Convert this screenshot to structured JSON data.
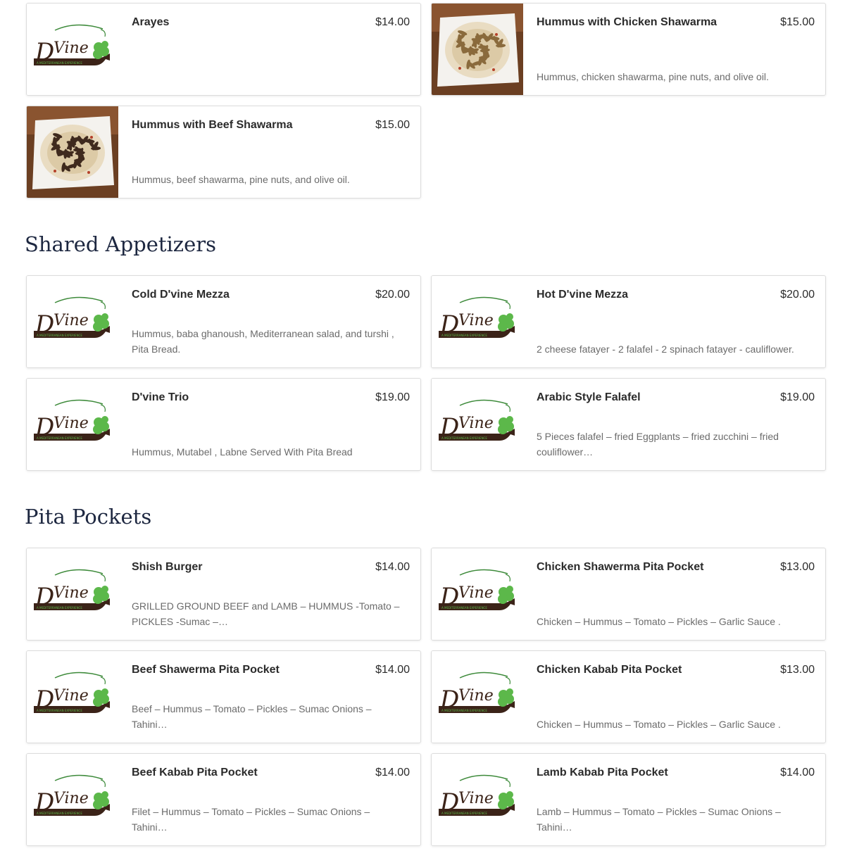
{
  "sections": [
    {
      "title": "",
      "items": [
        {
          "name": "Arayes",
          "price": "$14.00",
          "description": "",
          "image": "logo"
        },
        {
          "name": "Hummus with Chicken Shawarma",
          "price": "$15.00",
          "description": "Hummus, chicken shawarma, pine nuts, and olive oil.",
          "image": "photo-chicken"
        },
        {
          "name": "Hummus with Beef Shawarma",
          "price": "$15.00",
          "description": "Hummus, beef shawarma, pine nuts, and olive oil.",
          "image": "photo-beef"
        }
      ]
    },
    {
      "title": "Shared Appetizers",
      "items": [
        {
          "name": "Cold D'vine Mezza",
          "price": "$20.00",
          "description": "Hummus, baba ghanoush, Mediterranean salad, and turshi , Pita Bread.",
          "image": "logo"
        },
        {
          "name": "Hot D'vine Mezza",
          "price": "$20.00",
          "description": "2 cheese fatayer - 2 falafel - 2 spinach fatayer - cauliflower.",
          "image": "logo"
        },
        {
          "name": "D'vine Trio",
          "price": "$19.00",
          "description": "Hummus, Mutabel , Labne Served With Pita Bread",
          "image": "logo"
        },
        {
          "name": "Arabic Style Falafel",
          "price": "$19.00",
          "description": "5 Pieces falafel – fried Eggplants – fried zucchini – fried couliflower…",
          "image": "logo"
        }
      ]
    },
    {
      "title": "Pita Pockets",
      "items": [
        {
          "name": "Shish Burger",
          "price": "$14.00",
          "description": "GRILLED GROUND BEEF and LAMB – HUMMUS -Tomato – PICKLES -Sumac –…",
          "image": "logo"
        },
        {
          "name": "Chicken Shawerma Pita Pocket",
          "price": "$13.00",
          "description": "Chicken  – Hummus – Tomato – Pickles – Garlic Sauce .",
          "image": "logo"
        },
        {
          "name": "Beef Shawerma Pita Pocket",
          "price": "$14.00",
          "description": "Beef – Hummus – Tomato – Pickles – Sumac Onions – Tahini…",
          "image": "logo"
        },
        {
          "name": "Chicken Kabab Pita Pocket",
          "price": "$13.00",
          "description": "Chicken – Hummus – Tomato – Pickles – Garlic Sauce .",
          "image": "logo"
        },
        {
          "name": "Beef Kabab Pita Pocket",
          "price": "$14.00",
          "description": "Filet – Hummus – Tomato – Pickles – Sumac Onions – Tahini…",
          "image": "logo"
        },
        {
          "name": "Lamb Kabab Pita Pocket",
          "price": "$14.00",
          "description": "Lamb – Hummus – Tomato – Pickles – Sumac Onions – Tahini…",
          "image": "logo"
        }
      ]
    }
  ],
  "logo": {
    "text": "D'Vine",
    "tagline": "A MEDITERRANEAN EXPERIENCE"
  },
  "colors": {
    "title": "#1d2740",
    "logo_brown": "#3b2318",
    "logo_green": "#5cb84a"
  }
}
